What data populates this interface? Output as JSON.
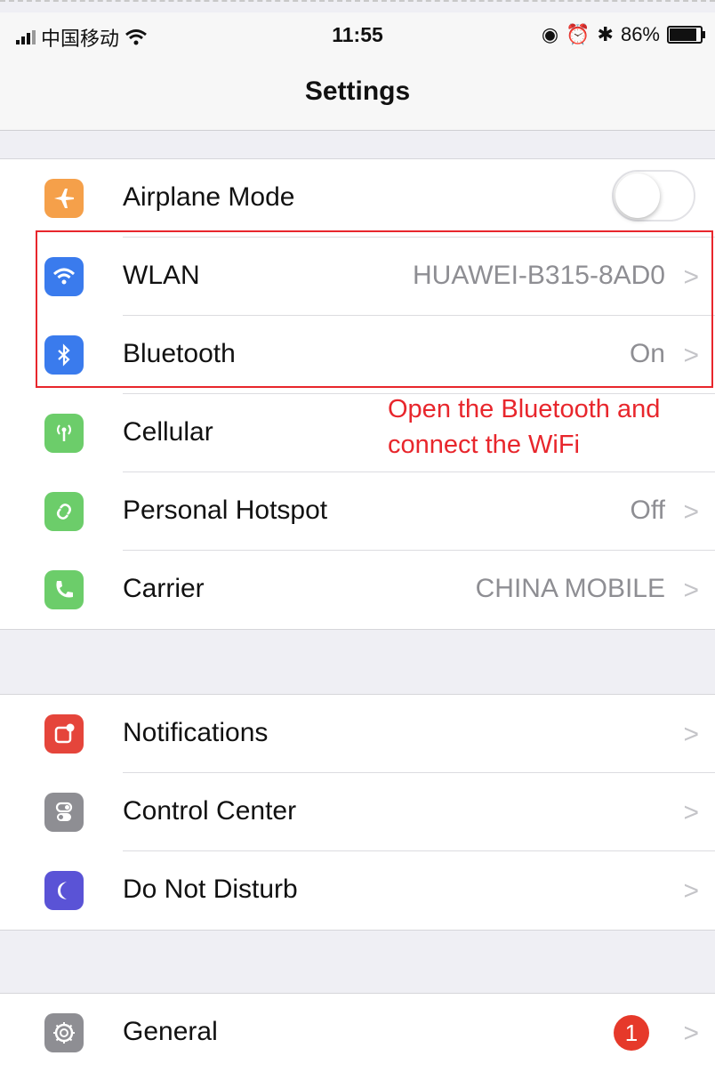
{
  "status_bar": {
    "carrier": "中国移动",
    "time": "11:55",
    "battery": "86%"
  },
  "nav": {
    "title": "Settings"
  },
  "group1": [
    {
      "label": "Airplane Mode",
      "icon": "airplane-icon",
      "color": "#f5a04a",
      "control": "toggle",
      "state": "off"
    },
    {
      "label": "WLAN",
      "value": "HUAWEI-B315-8AD0",
      "icon": "wifi-icon",
      "color": "#3a7bed"
    },
    {
      "label": "Bluetooth",
      "value": "On",
      "icon": "bluetooth-icon",
      "color": "#3a7bed"
    },
    {
      "label": "Cellular",
      "icon": "cellular-icon",
      "color": "#6ccd6a"
    },
    {
      "label": "Personal Hotspot",
      "value": "Off",
      "icon": "hotspot-icon",
      "color": "#6ccd6a"
    },
    {
      "label": "Carrier",
      "value": "CHINA MOBILE",
      "icon": "phone-icon",
      "color": "#6ccd6a"
    }
  ],
  "group2": [
    {
      "label": "Notifications",
      "icon": "notifications-icon",
      "color": "#e5453b"
    },
    {
      "label": "Control Center",
      "icon": "control-center-icon",
      "color": "#8e8e93"
    },
    {
      "label": "Do Not Disturb",
      "icon": "moon-icon",
      "color": "#5a53d6"
    }
  ],
  "group3": [
    {
      "label": "General",
      "badge": "1",
      "icon": "gear-icon",
      "color": "#8e8e93"
    }
  ],
  "annotation": {
    "line1": "Open the Bluetooth and",
    "line2": "connect the WiFi",
    "color": "#e8262c"
  },
  "chevron": ">"
}
